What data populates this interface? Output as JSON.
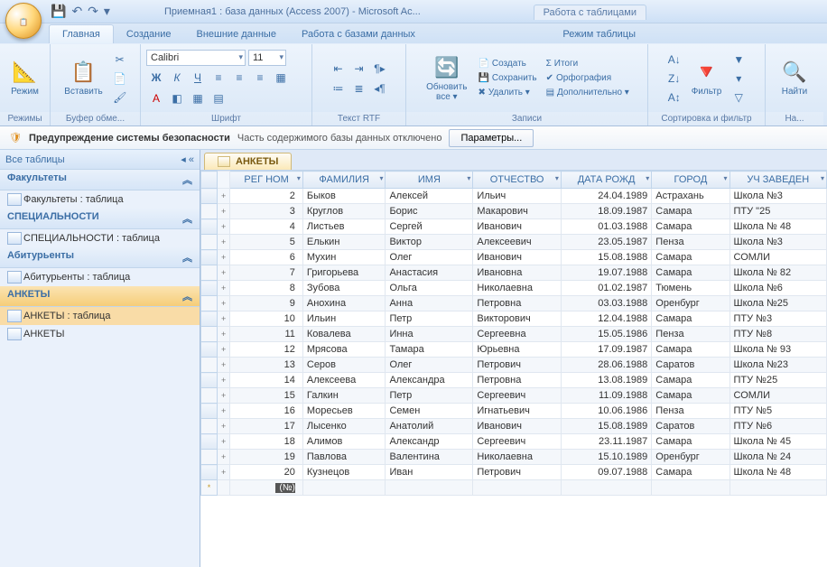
{
  "title": "Приемная1 : база данных (Access 2007) - Microsoft Ac...",
  "table_tools": {
    "header": "Работа с таблицами",
    "tab": "Режим таблицы"
  },
  "qat": {
    "save": "💾",
    "undo": "↶",
    "redo": "↷",
    "dd": "▾"
  },
  "tabs": {
    "home": "Главная",
    "create": "Создание",
    "external": "Внешние данные",
    "dbtools": "Работа с базами данных"
  },
  "ribbon": {
    "mode": {
      "label": "Режим",
      "group": "Режимы"
    },
    "clipboard": {
      "paste": "Вставить",
      "group": "Буфер обме..."
    },
    "font": {
      "name": "Calibri",
      "size": "11",
      "group": "Шрифт"
    },
    "rtf": {
      "group": "Текст RTF"
    },
    "refresh": {
      "label": "Обновить",
      "sub": "все ▾"
    },
    "records": {
      "new": "Создать",
      "save": "Сохранить",
      "delete": "Удалить ▾",
      "totals": "Итоги",
      "spell": "Орфография",
      "more": "Дополнительно ▾",
      "group": "Записи"
    },
    "sortfilter": {
      "filter": "Фильтр",
      "group": "Сортировка и фильтр"
    },
    "find": {
      "label": "Найти",
      "group": "На..."
    }
  },
  "security": {
    "title": "Предупреждение системы безопасности",
    "msg": "Часть содержимого базы данных отключено",
    "btn": "Параметры..."
  },
  "nav": {
    "header": "Все таблицы",
    "sections": [
      {
        "title": "Факультеты",
        "items": [
          "Факультеты : таблица"
        ]
      },
      {
        "title": "СПЕЦИАЛЬНОСТИ",
        "items": [
          "СПЕЦИАЛЬНОСТИ : таблица"
        ]
      },
      {
        "title": "Абитурьенты",
        "items": [
          "Абитурьенты : таблица"
        ]
      },
      {
        "title": "АНКЕТЫ",
        "items": [
          "АНКЕТЫ : таблица",
          "АНКЕТЫ"
        ],
        "selected": true,
        "selIndex": 0
      }
    ]
  },
  "doc_tab": "АНКЕТЫ",
  "columns": [
    "РЕГ НОМ",
    "ФАМИЛИЯ",
    "ИМЯ",
    "ОТЧЕСТВО",
    "ДАТА РОЖД",
    "ГОРОД",
    "УЧ ЗАВЕДЕН"
  ],
  "rows": [
    {
      "n": "2",
      "f": "Быков",
      "i": "Алексей",
      "o": "Ильич",
      "d": "24.04.1989",
      "g": "Астрахань",
      "u": "Школа №3"
    },
    {
      "n": "3",
      "f": "Круглов",
      "i": "Борис",
      "o": "Макарович",
      "d": "18.09.1987",
      "g": "Самара",
      "u": "ПТУ \"25"
    },
    {
      "n": "4",
      "f": "Листьев",
      "i": "Сергей",
      "o": "Иванович",
      "d": "01.03.1988",
      "g": "Самара",
      "u": "Школа № 48"
    },
    {
      "n": "5",
      "f": "Елькин",
      "i": "Виктор",
      "o": "Алексеевич",
      "d": "23.05.1987",
      "g": "Пенза",
      "u": "Школа №3"
    },
    {
      "n": "6",
      "f": "Мухин",
      "i": "Олег",
      "o": "Иванович",
      "d": "15.08.1988",
      "g": "Самара",
      "u": "СОМЛИ"
    },
    {
      "n": "7",
      "f": "Григорьева",
      "i": "Анастасия",
      "o": "Ивановна",
      "d": "19.07.1988",
      "g": "Самара",
      "u": "Школа № 82"
    },
    {
      "n": "8",
      "f": "Зубова",
      "i": "Ольга",
      "o": "Николаевна",
      "d": "01.02.1987",
      "g": "Тюмень",
      "u": "Школа №6"
    },
    {
      "n": "9",
      "f": "Анохина",
      "i": "Анна",
      "o": "Петровна",
      "d": "03.03.1988",
      "g": "Оренбург",
      "u": "Школа №25"
    },
    {
      "n": "10",
      "f": "Ильин",
      "i": "Петр",
      "o": "Викторович",
      "d": "12.04.1988",
      "g": "Самара",
      "u": "ПТУ №3"
    },
    {
      "n": "11",
      "f": "Ковалева",
      "i": "Инна",
      "o": "Сергеевна",
      "d": "15.05.1986",
      "g": "Пенза",
      "u": "ПТУ №8"
    },
    {
      "n": "12",
      "f": "Мрясова",
      "i": "Тамара",
      "o": "Юрьевна",
      "d": "17.09.1987",
      "g": "Самара",
      "u": "Школа № 93"
    },
    {
      "n": "13",
      "f": "Серов",
      "i": "Олег",
      "o": "Петрович",
      "d": "28.06.1988",
      "g": "Саратов",
      "u": "Школа №23"
    },
    {
      "n": "14",
      "f": "Алексеева",
      "i": "Александра",
      "o": "Петровна",
      "d": "13.08.1989",
      "g": "Самара",
      "u": "ПТУ №25"
    },
    {
      "n": "15",
      "f": "Галкин",
      "i": "Петр",
      "o": "Сергеевич",
      "d": "11.09.1988",
      "g": "Самара",
      "u": "СОМЛИ"
    },
    {
      "n": "16",
      "f": "Моресьев",
      "i": "Семен",
      "o": "Игнатьевич",
      "d": "10.06.1986",
      "g": "Пенза",
      "u": "ПТУ №5"
    },
    {
      "n": "17",
      "f": "Лысенко",
      "i": "Анатолий",
      "o": "Иванович",
      "d": "15.08.1989",
      "g": "Саратов",
      "u": "ПТУ №6"
    },
    {
      "n": "18",
      "f": "Алимов",
      "i": "Александр",
      "o": "Сергеевич",
      "d": "23.11.1987",
      "g": "Самара",
      "u": "Школа № 45"
    },
    {
      "n": "19",
      "f": "Павлова",
      "i": "Валентина",
      "o": "Николаевна",
      "d": "15.10.1989",
      "g": "Оренбург",
      "u": "Школа № 24"
    },
    {
      "n": "20",
      "f": "Кузнецов",
      "i": "Иван",
      "o": "Петрович",
      "d": "09.07.1988",
      "g": "Самара",
      "u": "Школа № 48"
    }
  ],
  "newrow_cell": "(№)"
}
